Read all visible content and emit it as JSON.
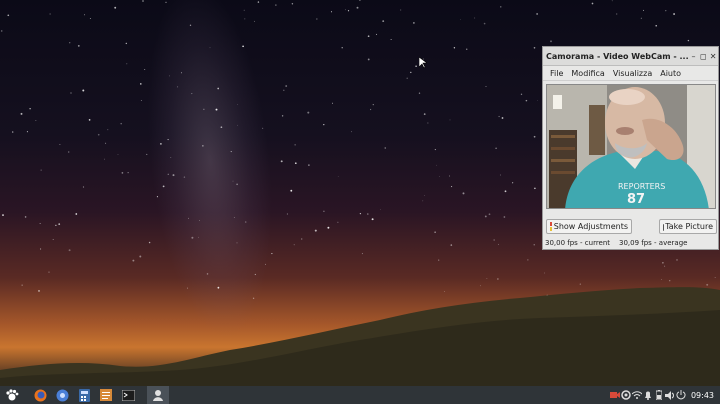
{
  "window": {
    "title": "Camorama - Video WebCam - ...",
    "controls": {
      "minimize": "–",
      "maximize": "◻",
      "close": "✕"
    }
  },
  "menu": [
    "File",
    "Modifica",
    "Visualizza",
    "Aiuto"
  ],
  "buttons": {
    "show_adjustments": "Show Adjustments",
    "take_picture": "Take Picture"
  },
  "status": {
    "current": "30,00 fps - current",
    "average": "30,09 fps - average"
  },
  "shirt_text": {
    "line1": "REPORTERS",
    "line2": "87"
  },
  "taskbar": {
    "launchers": [
      "menu-paw-icon",
      "firefox-icon",
      "chromium-icon",
      "calculator-icon",
      "text-editor-icon",
      "terminal-icon",
      "camorama-icon"
    ],
    "tray": [
      "webcam-icon",
      "settings-icon",
      "wifi-icon",
      "notification-icon",
      "battery-icon",
      "volume-icon",
      "power-icon"
    ],
    "clock": "09:43"
  },
  "colors": {
    "taskbar": "#2f3438",
    "window_bg": "#e8e8e7",
    "shirt": "#3fa8b0"
  }
}
